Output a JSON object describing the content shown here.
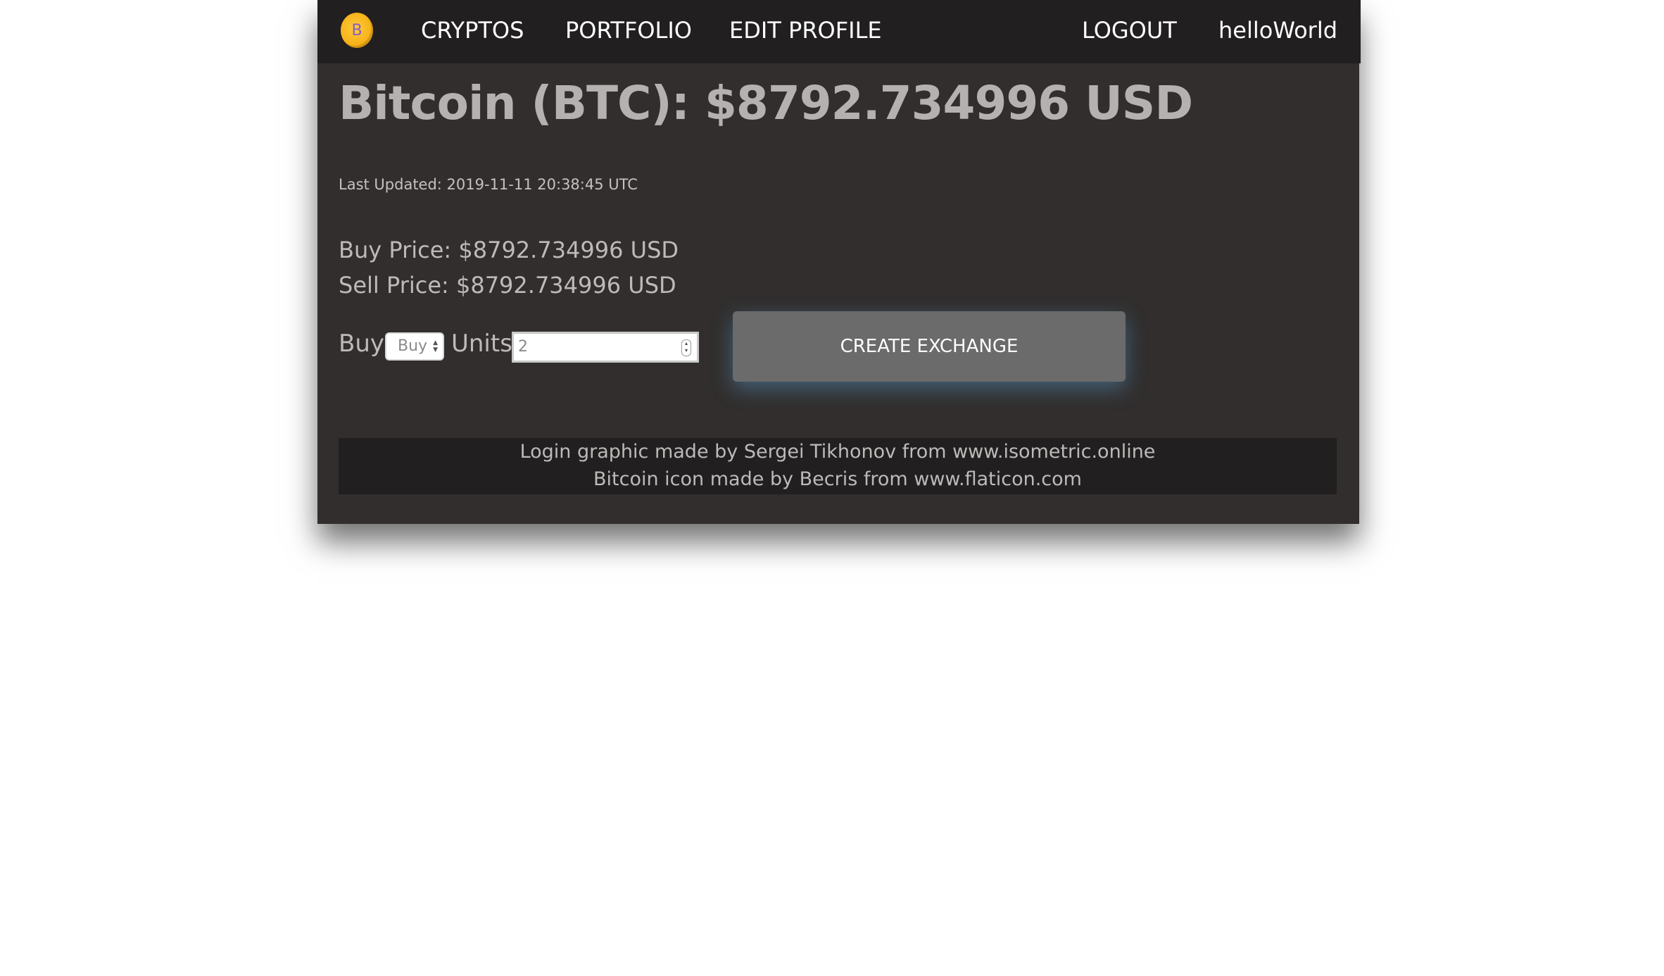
{
  "nav": {
    "logo_letter": "B",
    "cryptos": "CRYPTOS",
    "portfolio": "PORTFOLIO",
    "edit_profile": "EDIT PROFILE",
    "logout": "LOGOUT",
    "username": "helloWorld"
  },
  "main": {
    "title": "Bitcoin (BTC): $8792.734996 USD",
    "last_updated": "Last Updated: 2019-11-11 20:38:45 UTC",
    "buy_price": "Buy Price: $8792.734996 USD",
    "sell_price": "Sell Price: $8792.734996 USD"
  },
  "exchange_form": {
    "action_label": "Buy",
    "action_selected": "Buy",
    "units_label": "Units",
    "units_value": "2",
    "submit_label": "CREATE EXCHANGE"
  },
  "footer": {
    "line1": "Login graphic made by Sergei Tikhonov from www.isometric.online",
    "line2": "Bitcoin icon made by Becris from www.flaticon.com"
  },
  "colors": {
    "navbar_bg": "#211f1f",
    "page_bg": "#312e2d",
    "button_bg": "#6b6b6b",
    "logo_gold": "#f6b21a"
  },
  "icons": {
    "logo": "bitcoin-coin-icon",
    "select_arrows": "updown-arrows-icon",
    "spinner": "number-spinner-icon"
  }
}
